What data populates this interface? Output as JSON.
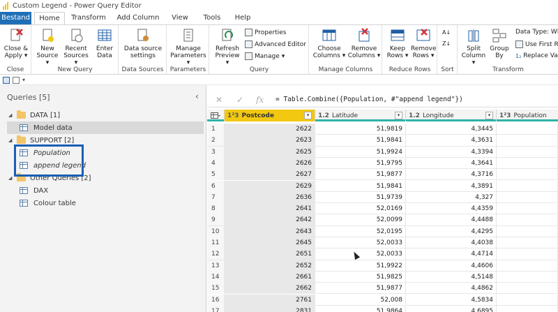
{
  "window": {
    "title": "Custom Legend - Power Query Editor"
  },
  "tabs": [
    "Bestand",
    "Home",
    "Transform",
    "Add Column",
    "View",
    "Tools",
    "Help"
  ],
  "ribbon": {
    "close": {
      "label1": "Close &",
      "label2": "Apply",
      "group": "Close"
    },
    "new_query": {
      "new_source": [
        "New",
        "Source"
      ],
      "recent_sources": [
        "Recent",
        "Sources"
      ],
      "enter_data": [
        "Enter",
        "Data"
      ],
      "group": "New Query"
    },
    "data_sources": {
      "btn": [
        "Data source",
        "settings"
      ],
      "group": "Data Sources"
    },
    "parameters": {
      "btn": [
        "Manage",
        "Parameters"
      ],
      "group": "Parameters"
    },
    "query": {
      "refresh": [
        "Refresh",
        "Preview"
      ],
      "properties": "Properties",
      "advanced": "Advanced Editor",
      "manage": "Manage",
      "group": "Query"
    },
    "manage_columns": {
      "choose": [
        "Choose",
        "Columns"
      ],
      "remove": [
        "Remove",
        "Columns"
      ],
      "group": "Manage Columns"
    },
    "reduce_rows": {
      "keep": [
        "Keep",
        "Rows"
      ],
      "remove": [
        "Remove",
        "Rows"
      ],
      "group": "Reduce Rows"
    },
    "sort": {
      "group": "Sort"
    },
    "transform": {
      "split": [
        "Split",
        "Column"
      ],
      "groupby": [
        "Group",
        "By"
      ],
      "datatype": "Data Type: Wh",
      "firstrow": "Use First R",
      "replace": "Replace Va",
      "group": "Transform"
    }
  },
  "queries": {
    "header": "Queries [5]",
    "data_folder": "DATA [1]",
    "model_data": "Model data",
    "support_folder": "SUPPORT [2]",
    "population": "Population",
    "append_legend": "append legend",
    "other_folder": "Other Queries [2]",
    "dax": "DAX",
    "colour_table": "Colour table"
  },
  "formula": {
    "text": "= Table.Combine({Population, #\"append legend\"})"
  },
  "columns": [
    {
      "type": "1²3",
      "name": "Postcode"
    },
    {
      "type": "1.2",
      "name": "Latitude"
    },
    {
      "type": "1.2",
      "name": "Longitude"
    },
    {
      "type": "1²3",
      "name": "Population"
    }
  ],
  "rows": [
    [
      "1",
      "2622",
      "51,9819",
      "4,3445"
    ],
    [
      "2",
      "2623",
      "51,9841",
      "4,3631"
    ],
    [
      "3",
      "2625",
      "51,9924",
      "4,3394"
    ],
    [
      "4",
      "2626",
      "51,9795",
      "4,3641"
    ],
    [
      "5",
      "2627",
      "51,9877",
      "4,3716"
    ],
    [
      "6",
      "2629",
      "51,9841",
      "4,3891"
    ],
    [
      "7",
      "2636",
      "51,9739",
      "4,327"
    ],
    [
      "8",
      "2641",
      "52,0169",
      "4,4359"
    ],
    [
      "9",
      "2642",
      "52,0099",
      "4,4488"
    ],
    [
      "10",
      "2643",
      "52,0195",
      "4,4295"
    ],
    [
      "11",
      "2645",
      "52,0033",
      "4,4038"
    ],
    [
      "12",
      "2651",
      "52,0033",
      "4,4714"
    ],
    [
      "13",
      "2652",
      "51,9922",
      "4,4606"
    ],
    [
      "14",
      "2661",
      "51,9825",
      "4,5148"
    ],
    [
      "15",
      "2662",
      "51,9877",
      "4,4862"
    ],
    [
      "16",
      "2761",
      "52,008",
      "4,5834"
    ],
    [
      "17",
      "2831",
      "51,9864",
      "4,6895"
    ]
  ]
}
